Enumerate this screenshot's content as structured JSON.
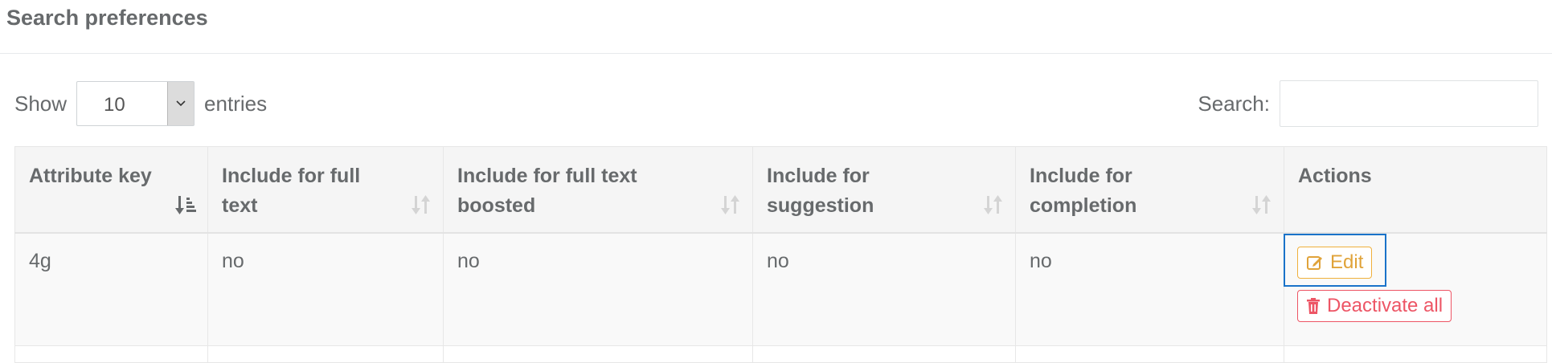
{
  "page": {
    "title": "Search preferences"
  },
  "length_control": {
    "show_label": "Show",
    "selected_value": "10",
    "entries_label": "entries"
  },
  "search": {
    "label": "Search:",
    "value": ""
  },
  "table": {
    "columns": [
      {
        "label": "Attribute key",
        "sort": "ascending"
      },
      {
        "label": "Include for full text",
        "sort": "none"
      },
      {
        "label": "Include for full text boosted",
        "sort": "none"
      },
      {
        "label": "Include for suggestion",
        "sort": "none"
      },
      {
        "label": "Include for completion",
        "sort": "none"
      },
      {
        "label": "Actions",
        "sort": "none"
      }
    ],
    "rows": [
      {
        "attribute_key": "4g",
        "full_text": "no",
        "full_text_boosted": "no",
        "suggestion": "no",
        "completion": "no"
      }
    ]
  },
  "actions": {
    "edit_label": "Edit",
    "deactivate_label": "Deactivate all"
  },
  "colors": {
    "edit": "#e0a33a",
    "deactivate": "#ed5565",
    "focus": "#1a73c9"
  }
}
